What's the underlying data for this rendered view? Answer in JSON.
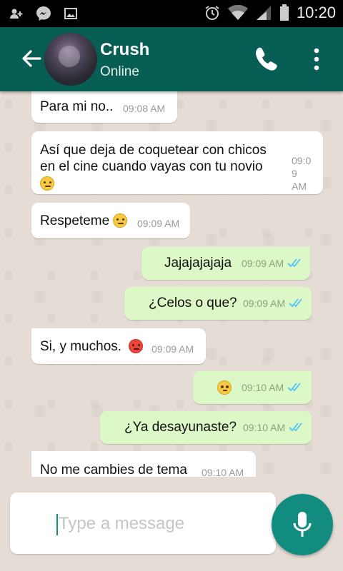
{
  "status_bar": {
    "time": "10:20"
  },
  "header": {
    "name": "Crush",
    "status": "Online"
  },
  "messages": [
    {
      "dir": "in",
      "text": "Para mi no..",
      "time": "09:08 AM"
    },
    {
      "dir": "in",
      "text": "Así que deja de coquetear con chicos",
      "text2": "en el cine cuando vayas con tu novio",
      "time_line1": "09:0",
      "time_line2": "9",
      "time_line3": "AM",
      "emoji": "unamused-face-emoji"
    },
    {
      "dir": "in",
      "text": "Respeteme",
      "time": "09:09 AM",
      "emoji": "pensive-face-emoji"
    },
    {
      "dir": "out",
      "text": "Jajajajajaja",
      "time": "09:09 AM",
      "read": true
    },
    {
      "dir": "out",
      "text": "¿Celos o que?",
      "time": "09:09 AM",
      "read": true
    },
    {
      "dir": "in",
      "text": "Si, y muchos.",
      "time": "09:09 AM",
      "emoji": "angry-face-emoji"
    },
    {
      "dir": "out",
      "text": "",
      "time": "09:10 AM",
      "read": true,
      "emoji": "flushed-face-emoji"
    },
    {
      "dir": "out",
      "text": "¿Ya desayunaste?",
      "time": "09:10 AM",
      "read": true
    },
    {
      "dir": "in",
      "text": "No me cambies de tema",
      "time": "09:10 AM"
    }
  ],
  "composer": {
    "placeholder": "Type a message"
  },
  "colors": {
    "header": "#075e54",
    "outgoing": "#dcf8c6",
    "incoming": "#ffffff",
    "ticks": "#4fc3f7",
    "mic": "#128c7e"
  }
}
